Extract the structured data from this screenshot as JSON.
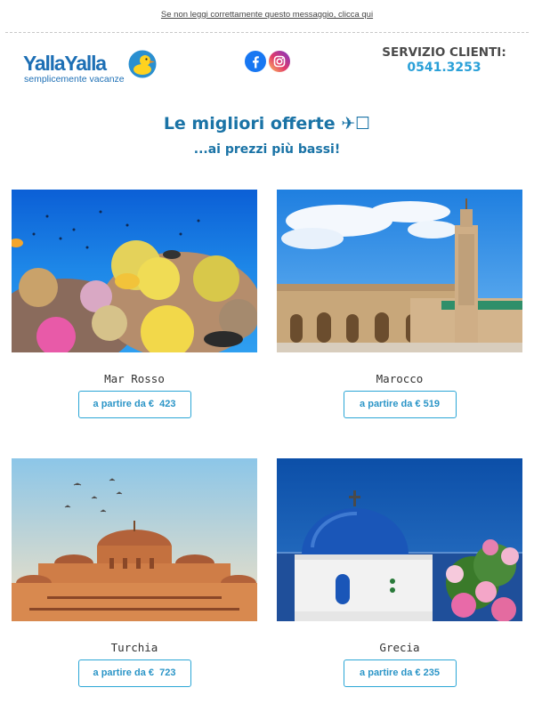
{
  "header": {
    "top_note": "Se non leggi correttamente questo messaggio, clicca qui",
    "logo_text": "YallaYalla",
    "logo_tagline": "semplicemente vacanze",
    "service_label": "SERVIZIO CLIENTI:",
    "service_phone": "0541.3253"
  },
  "social": [
    "facebook-icon",
    "instagram-icon"
  ],
  "colors": {
    "brand_blue": "#1d6fb5",
    "accent_cyan": "#2aa0d8",
    "headline": "#1a73a6"
  },
  "hero": {
    "title": "Le migliori offerte ✈☐",
    "subtitle": "...ai prezzi più bassi!"
  },
  "offers": [
    {
      "destination": "Mar Rosso",
      "cta": "a partire da €  423"
    },
    {
      "destination": "Marocco",
      "cta": "a partire da € 519"
    },
    {
      "destination": "Turchia",
      "cta": "a partire da €  723"
    },
    {
      "destination": "Grecia",
      "cta": "a partire da € 235"
    }
  ]
}
